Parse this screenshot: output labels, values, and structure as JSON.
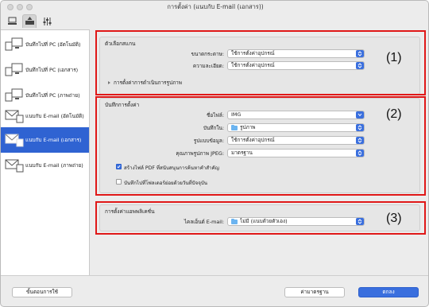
{
  "window": {
    "title": "การตั้งค่า (แนบกับ E-mail (เอกสาร))"
  },
  "tabs": [
    {
      "icon": "scan-from-computer-icon"
    },
    {
      "icon": "scan-from-operation-panel-icon"
    },
    {
      "icon": "general-settings-icon"
    }
  ],
  "sidebar": {
    "items": [
      {
        "label": "บันทึกไปที่ PC (อัตโนมัติ)",
        "icon": "save-to-pc-icon"
      },
      {
        "label": "บันทึกไปที่ PC (เอกสาร)",
        "icon": "save-to-pc-icon"
      },
      {
        "label": "บันทึกไปที่ PC (ภาพถ่าย)",
        "icon": "save-to-pc-icon"
      },
      {
        "label": "แนบกับ E-mail (อัตโนมัติ)",
        "icon": "email-icon"
      },
      {
        "label": "แนบกับ E-mail (เอกสาร)",
        "icon": "email-icon"
      },
      {
        "label": "แนบกับ E-mail (ภาพถ่าย)",
        "icon": "email-icon"
      }
    ]
  },
  "scan_options": {
    "title": "ตัวเลือกสแกน",
    "paper_size": {
      "label": "ขนาดกระดาษ:",
      "value": "ใช้การตั้งค่าอุปกรณ์"
    },
    "resolution": {
      "label": "ความละเอียด:",
      "value": "ใช้การตั้งค่าอุปกรณ์"
    },
    "image_processing": {
      "label": "การตั้งค่าการดำเนินการรูปภาพ"
    }
  },
  "save_settings": {
    "title": "บันทึกการตั้งค่า",
    "file_name": {
      "label": "ชื่อไฟล์:",
      "value": "IMG"
    },
    "save_in": {
      "label": "บันทึกใน:",
      "value": "รูปภาพ"
    },
    "data_format": {
      "label": "รูปแบบข้อมูล:",
      "value": "ใช้การตั้งค่าอุปกรณ์"
    },
    "jpeg_quality": {
      "label": "คุณภาพรูปภาพ JPEG:",
      "value": "มาตรฐาน"
    },
    "create_pdf_keyword": {
      "label": "สร้างไฟล์ PDF ที่สนับสนุนการค้นหาคำสำคัญ",
      "checked": true
    },
    "save_subfolder": {
      "label": "บันทึกไปที่โฟลเดอร์ย่อยด้วยวันที่ปัจจุบัน",
      "checked": false
    }
  },
  "app_settings": {
    "title": "การตั้งค่าแอพพลิเคชั่น",
    "email_client": {
      "label": "ไคลเอ็นต์ E-mail:",
      "value": "ไม่มี (แนบด้วยตัวเอง)"
    }
  },
  "callouts": {
    "one": "(1)",
    "two": "(2)",
    "three": "(3)"
  },
  "buttons": {
    "instructions": "ขั้นตอนการใช้",
    "defaults": "ค่ามาตรฐาน",
    "ok": "ตกลง"
  },
  "colors": {
    "accent": "#2f63d2",
    "callout": "#e01818"
  }
}
